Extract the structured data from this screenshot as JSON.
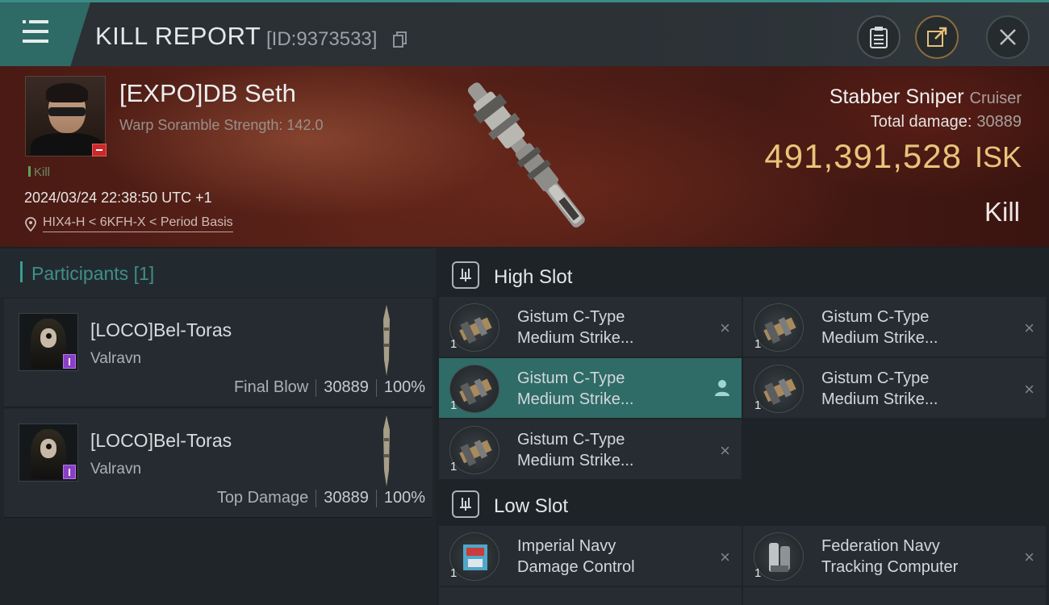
{
  "header": {
    "title": "KILL REPORT",
    "report_id": "[ID:9373533]",
    "icons": [
      "menu-icon",
      "copy-icon",
      "clipboard-icon",
      "share-icon",
      "close-icon"
    ]
  },
  "victim": {
    "name": "[EXPO]DB Seth",
    "warp_scramble": "Warp Soramble Strength: 142.0",
    "tag": "Kill",
    "timestamp": "2024/03/24 22:38:50 UTC +1",
    "location": "HIX4-H < 6KFH-X < Period Basis",
    "ship_name": "Stabber Sniper",
    "ship_class": "Cruiser",
    "total_damage_label": "Total damage:",
    "total_damage_value": "30889",
    "isk_value": "491,391,528",
    "isk_unit": "ISK",
    "result": "Kill"
  },
  "participants": {
    "title": "Participants",
    "count": "[1]",
    "rows": [
      {
        "name": "[LOCO]Bel-Toras",
        "ship": "Valravn",
        "role": "Final Blow",
        "damage": "30889",
        "percent": "100%"
      },
      {
        "name": "[LOCO]Bel-Toras",
        "ship": "Valravn",
        "role": "Top Damage",
        "damage": "30889",
        "percent": "100%"
      }
    ]
  },
  "fitting": {
    "high_slot": {
      "title": "High Slot",
      "modules": [
        {
          "line1": "Gistum C-Type",
          "line2": "Medium Strike...",
          "qty": "1",
          "state": "destroyed"
        },
        {
          "line1": "Gistum C-Type",
          "line2": "Medium Strike...",
          "qty": "1",
          "state": "destroyed"
        },
        {
          "line1": "Gistum C-Type",
          "line2": "Medium Strike...",
          "qty": "1",
          "state": "dropped"
        },
        {
          "line1": "Gistum C-Type",
          "line2": "Medium Strike...",
          "qty": "1",
          "state": "destroyed"
        },
        {
          "line1": "Gistum C-Type",
          "line2": "Medium Strike...",
          "qty": "1",
          "state": "destroyed"
        }
      ]
    },
    "low_slot": {
      "title": "Low Slot",
      "modules": [
        {
          "line1": "Imperial Navy",
          "line2": "Damage Control",
          "qty": "1",
          "state": "destroyed"
        },
        {
          "line1": "Federation Navy",
          "line2": "Tracking Computer",
          "qty": "1",
          "state": "destroyed"
        }
      ]
    },
    "destroyed_mark": "×"
  },
  "colors": {
    "accent_teal": "#2f6b67",
    "isk_gold": "#e9c47a",
    "victim_banner": "#4a1a14"
  }
}
